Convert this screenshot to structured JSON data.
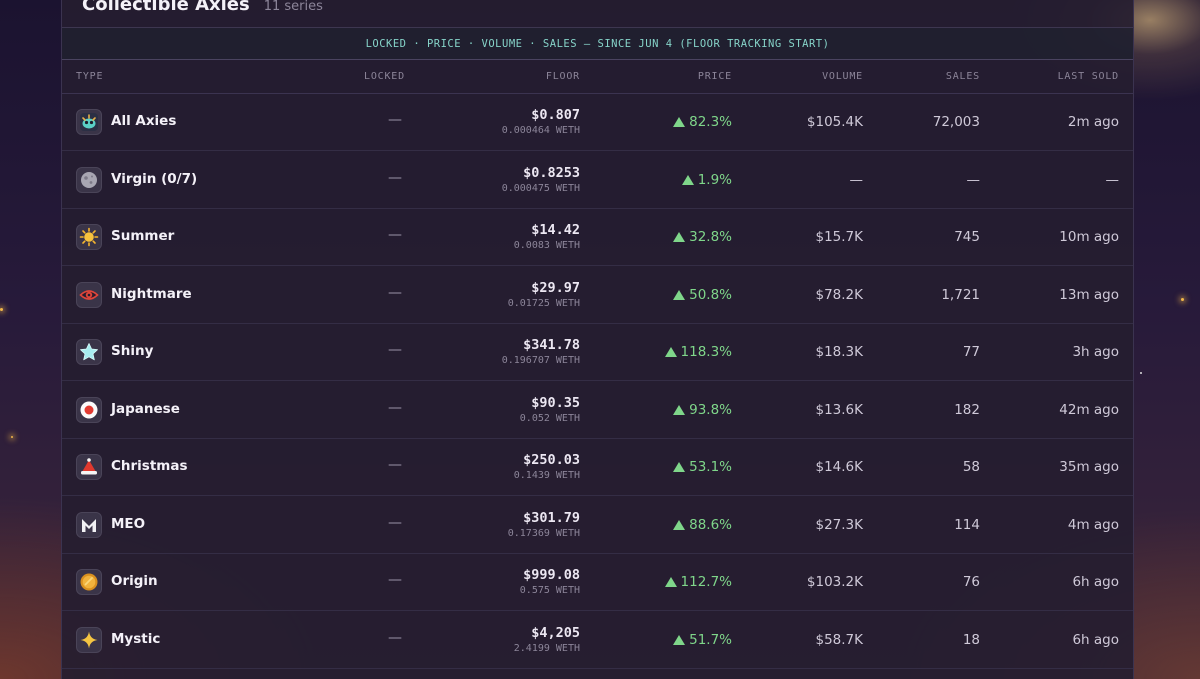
{
  "header": {
    "title": "Collectible Axies",
    "subtitle": "11 series"
  },
  "banner": "LOCKED · PRICE · VOLUME · SALES — SINCE JUN 4 (FLOOR TRACKING START)",
  "columns": {
    "type": "TYPE",
    "locked": "LOCKED",
    "floor": "FLOOR",
    "price": "PRICE",
    "volume": "VOLUME",
    "sales": "SALES",
    "last_sold": "LAST SOLD"
  },
  "colors": {
    "up": "#7fd68a",
    "banner": "#86d4c9"
  },
  "rows": [
    {
      "icon": "axie-icon",
      "name": "All Axies",
      "locked": "—",
      "floor_usd": "$0.807",
      "floor_eth": "0.000464 WETH",
      "price": "82.3%",
      "volume": "$105.4K",
      "sales": "72,003",
      "last_sold": "2m ago"
    },
    {
      "icon": "moon-icon",
      "name": "Virgin (0/7)",
      "locked": "—",
      "floor_usd": "$0.8253",
      "floor_eth": "0.000475 WETH",
      "price": "1.9%",
      "volume": "—",
      "sales": "—",
      "last_sold": "—"
    },
    {
      "icon": "sun-icon",
      "name": "Summer",
      "locked": "—",
      "floor_usd": "$14.42",
      "floor_eth": "0.0083 WETH",
      "price": "32.8%",
      "volume": "$15.7K",
      "sales": "745",
      "last_sold": "10m ago"
    },
    {
      "icon": "eye-icon",
      "name": "Nightmare",
      "locked": "—",
      "floor_usd": "$29.97",
      "floor_eth": "0.01725 WETH",
      "price": "50.8%",
      "volume": "$78.2K",
      "sales": "1,721",
      "last_sold": "13m ago"
    },
    {
      "icon": "star-icon",
      "name": "Shiny",
      "locked": "—",
      "floor_usd": "$341.78",
      "floor_eth": "0.196707 WETH",
      "price": "118.3%",
      "volume": "$18.3K",
      "sales": "77",
      "last_sold": "3h ago"
    },
    {
      "icon": "japan-flag-icon",
      "name": "Japanese",
      "locked": "—",
      "floor_usd": "$90.35",
      "floor_eth": "0.052 WETH",
      "price": "93.8%",
      "volume": "$13.6K",
      "sales": "182",
      "last_sold": "42m ago"
    },
    {
      "icon": "santa-hat-icon",
      "name": "Christmas",
      "locked": "—",
      "floor_usd": "$250.03",
      "floor_eth": "0.1439 WETH",
      "price": "53.1%",
      "volume": "$14.6K",
      "sales": "58",
      "last_sold": "35m ago"
    },
    {
      "icon": "meo-logo-icon",
      "name": "MEO",
      "locked": "—",
      "floor_usd": "$301.79",
      "floor_eth": "0.17369 WETH",
      "price": "88.6%",
      "volume": "$27.3K",
      "sales": "114",
      "last_sold": "4m ago"
    },
    {
      "icon": "coin-icon",
      "name": "Origin",
      "locked": "—",
      "floor_usd": "$999.08",
      "floor_eth": "0.575 WETH",
      "price": "112.7%",
      "volume": "$103.2K",
      "sales": "76",
      "last_sold": "6h ago"
    },
    {
      "icon": "sparkle-icon",
      "name": "Mystic",
      "locked": "—",
      "floor_usd": "$4,205",
      "floor_eth": "2.4199 WETH",
      "price": "51.7%",
      "volume": "$58.7K",
      "sales": "18",
      "last_sold": "6h ago"
    }
  ]
}
